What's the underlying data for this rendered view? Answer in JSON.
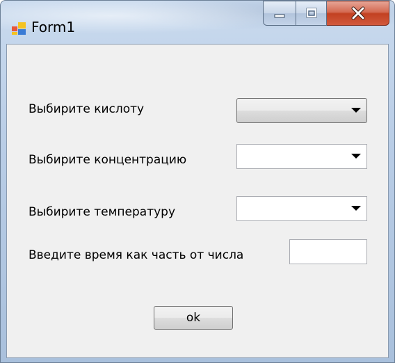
{
  "window": {
    "title": "Form1"
  },
  "form": {
    "acid_label": "Выбирите кислоту",
    "acid_value": "",
    "concentration_label": "Выбирите концентрацию",
    "concentration_value": "",
    "temperature_label": "Выбирите температуру",
    "temperature_value": "",
    "time_label": "Введите время как часть от числа",
    "time_value": "",
    "ok_label": "ok"
  },
  "colors": {
    "client_bg": "#f0f0f0",
    "close_button": "#c24122"
  },
  "icons": [
    "app-form-icon",
    "minimize-icon",
    "maximize-icon",
    "close-icon",
    "dropdown-arrow-icon"
  ]
}
